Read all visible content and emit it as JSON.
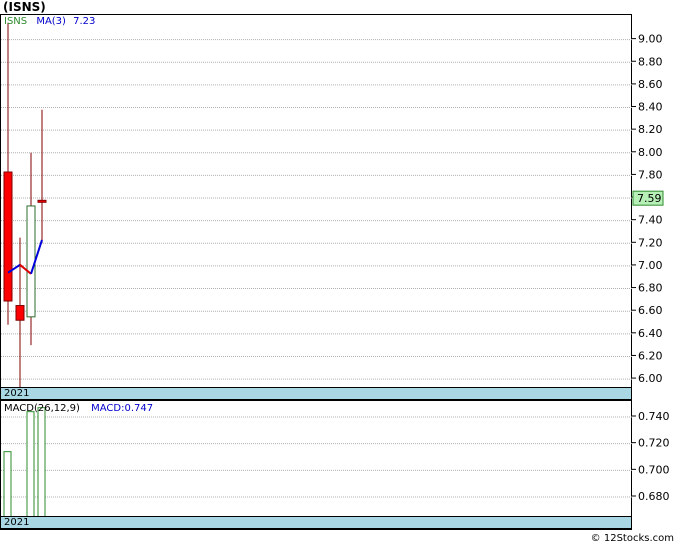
{
  "header": {
    "title": "(ISNS)"
  },
  "price_panel": {
    "ticker": "ISNS",
    "ma_label": "MA(3)",
    "ma_value": "7.23",
    "current_price": "7.59",
    "period_label": "2021"
  },
  "macd_panel": {
    "label": "MACD(26,12,9)",
    "value_label": "MACD:0.747",
    "period_label": "2021"
  },
  "footer": {
    "watermark": "© 12Stocks.com"
  },
  "colors": {
    "up_candle_border": "#2e6b2e",
    "down_candle_fill": "#ff0000",
    "wick": "#800000",
    "ma_up": "#0000dd",
    "ma_down": "#dd0000",
    "price_badge": "#b6f0b6",
    "macd_bar": "#2e8b2e"
  },
  "chart_data": [
    {
      "type": "candlestick",
      "ylim": [
        5.93,
        9.2
      ],
      "yticks": [
        6.0,
        6.2,
        6.4,
        6.6,
        6.8,
        7.0,
        7.2,
        7.4,
        7.6,
        7.8,
        8.0,
        8.2,
        8.4,
        8.6,
        8.8,
        9.0
      ],
      "candles": [
        {
          "open": 7.83,
          "high": 9.15,
          "low": 6.48,
          "close": 6.69,
          "direction": "down"
        },
        {
          "open": 6.65,
          "high": 7.25,
          "low": 5.93,
          "close": 6.52,
          "direction": "down"
        },
        {
          "open": 6.55,
          "high": 8.0,
          "low": 6.3,
          "close": 7.53,
          "direction": "up"
        },
        {
          "open": 7.58,
          "high": 8.38,
          "low": 7.2,
          "close": 7.58,
          "direction": "down"
        }
      ],
      "ma": [
        6.94,
        7.01,
        6.93,
        7.23
      ],
      "grid": true
    },
    {
      "type": "bar",
      "series_name": "MACD(26,12,9)",
      "ylim": [
        0.665,
        0.752
      ],
      "yticks": [
        0.68,
        0.7,
        0.72,
        0.74
      ],
      "values": [
        0.714,
        0.744,
        0.747
      ],
      "bar_slots": [
        0,
        2,
        3
      ],
      "grid": true
    }
  ]
}
